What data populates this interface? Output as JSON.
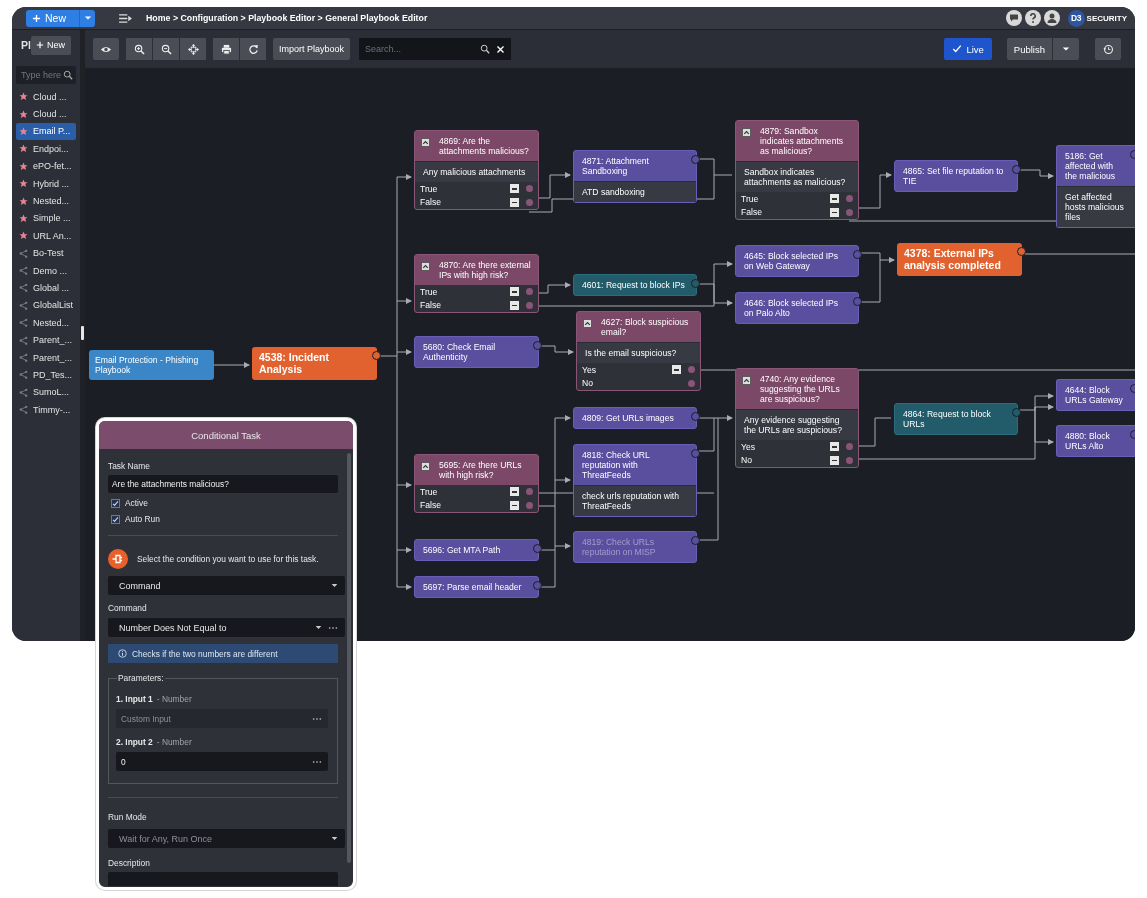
{
  "top_bar": {
    "new_button": "New",
    "breadcrumb": "Home > Configuration > Playbook Editor > General Playbook Editor",
    "logo": {
      "mark": "D3",
      "name": "SECURITY"
    }
  },
  "toolbar": {
    "import_button": "Import Playbook",
    "search": {
      "placeholder": "Search..."
    },
    "live_button": "Live",
    "publish_button": "Publish"
  },
  "sidebar": {
    "title": "Pl",
    "new_button": "New",
    "search": {
      "placeholder": "Type here"
    },
    "items": [
      {
        "label": "Cloud ...",
        "kind": "favorite",
        "selected": false
      },
      {
        "label": "Cloud ...",
        "kind": "favorite",
        "selected": false
      },
      {
        "label": "Email P...",
        "kind": "favorite",
        "selected": true
      },
      {
        "label": "Endpoi...",
        "kind": "favorite",
        "selected": false
      },
      {
        "label": "ePO-fet...",
        "kind": "favorite",
        "selected": false
      },
      {
        "label": "Hybrid ...",
        "kind": "favorite",
        "selected": false
      },
      {
        "label": "Nested...",
        "kind": "favorite",
        "selected": false
      },
      {
        "label": "Simple ...",
        "kind": "favorite",
        "selected": false
      },
      {
        "label": "URL An...",
        "kind": "favorite",
        "selected": false
      },
      {
        "label": "Bo-Test",
        "kind": "shared",
        "selected": false
      },
      {
        "label": "Demo ...",
        "kind": "shared",
        "selected": false
      },
      {
        "label": "Global ...",
        "kind": "shared",
        "selected": false
      },
      {
        "label": "GlobalList",
        "kind": "shared",
        "selected": false
      },
      {
        "label": "Nested...",
        "kind": "shared",
        "selected": false
      },
      {
        "label": "Parent_...",
        "kind": "shared",
        "selected": false
      },
      {
        "label": "Parent_...",
        "kind": "shared",
        "selected": false
      },
      {
        "label": "PD_Tes...",
        "kind": "shared",
        "selected": false
      },
      {
        "label": "SumoL...",
        "kind": "shared",
        "selected": false
      },
      {
        "label": "Timmy-...",
        "kind": "shared",
        "selected": false
      }
    ]
  },
  "canvas": {
    "nodes": [
      {
        "kind": "start",
        "title": "Email Protection - Phishing Playbook",
        "disabled": false
      },
      {
        "kind": "incident",
        "title": "4538: Incident Analysis",
        "disabled": false
      },
      {
        "kind": "conditional",
        "title": "4869: Are the attachments malicious?",
        "description": "Any malicious attachments",
        "disabled": false,
        "outputs": [
          {
            "label": "True",
            "collapsible": true
          },
          {
            "label": "False",
            "collapsible": true
          }
        ]
      },
      {
        "kind": "task",
        "title": "4871: Attachment Sandboxing",
        "description": "ATD sandboxing",
        "disabled": false
      },
      {
        "kind": "conditional",
        "title": "4879: Sandbox indicates attachments as malicious?",
        "description": "Sandbox indicates attachments as malicious?",
        "disabled": false,
        "outputs": [
          {
            "label": "True",
            "collapsible": true
          },
          {
            "label": "False",
            "collapsible": true
          }
        ]
      },
      {
        "kind": "task",
        "title": "4865: Set file reputation to TIE",
        "disabled": false
      },
      {
        "kind": "task",
        "title": "5186: Get affected with the malicious",
        "description": "Get affected hosts malicious files",
        "disabled": false
      },
      {
        "kind": "conditional",
        "title": "4870: Are there external IPs with high risk?",
        "disabled": false,
        "outputs": [
          {
            "label": "True",
            "collapsible": true
          },
          {
            "label": "False",
            "collapsible": true
          }
        ]
      },
      {
        "kind": "request",
        "title": "4601: Request to block IPs",
        "disabled": false
      },
      {
        "kind": "task",
        "title": "4645: Block selected IPs on Web Gateway",
        "disabled": false
      },
      {
        "kind": "task",
        "title": "4646: Block selected IPs on Palo Alto",
        "disabled": false
      },
      {
        "kind": "incident",
        "title": "4378: External IPs analysis completed",
        "disabled": false
      },
      {
        "kind": "task",
        "title": "5680: Check Email Authenticity",
        "disabled": false
      },
      {
        "kind": "conditional",
        "title": "4627: Block suspicious email?",
        "description": "Is the email suspicious?",
        "disabled": false,
        "outputs": [
          {
            "label": "Yes",
            "collapsible": true
          },
          {
            "label": "No",
            "collapsible": false
          }
        ]
      },
      {
        "kind": "task",
        "title": "4809: Get URLs images",
        "disabled": false
      },
      {
        "kind": "conditional",
        "title": "4740: Any evidence suggesting the URLs are suspicious?",
        "description": "Any evidence suggesting the URLs are suspicious?",
        "disabled": false,
        "outputs": [
          {
            "label": "Yes",
            "collapsible": true
          },
          {
            "label": "No",
            "collapsible": true
          }
        ]
      },
      {
        "kind": "request",
        "title": "4864: Request to block URLs",
        "disabled": false
      },
      {
        "kind": "task",
        "title": "4644: Block URLs Gateway",
        "disabled": false
      },
      {
        "kind": "task",
        "title": "4880: Block URLs Alto",
        "disabled": false
      },
      {
        "kind": "conditional",
        "title": "5695: Are there URLs with high risk?",
        "disabled": false,
        "outputs": [
          {
            "label": "True",
            "collapsible": true
          },
          {
            "label": "False",
            "collapsible": true
          }
        ]
      },
      {
        "kind": "task",
        "title": "4818: Check URL reputation with ThreatFeeds",
        "description": "check urls reputation with ThreatFeeds",
        "disabled": false
      },
      {
        "kind": "task",
        "title": "5696: Get MTA Path",
        "disabled": false
      },
      {
        "kind": "task",
        "title": "4819: Check URLs reputation on MISP",
        "disabled": true
      },
      {
        "kind": "task",
        "title": "5697: Parse email header",
        "disabled": false
      }
    ]
  },
  "task_panel": {
    "title": "Conditional Task",
    "task_name": {
      "label": "Task Name",
      "value": "Are the attachments malicious?"
    },
    "options": [
      {
        "label": "Active",
        "checked": true
      },
      {
        "label": "Auto Run",
        "checked": true
      }
    ],
    "condition_prompt": "Select the condition you want to use for this task.",
    "condition_type": "Command",
    "command": {
      "label": "Command",
      "value": "Number Does Not Equal to"
    },
    "info": "Checks if the two numbers are different",
    "parameters": {
      "legend": "Parameters:",
      "inputs": [
        {
          "name": "1. Input 1",
          "type": "- Number",
          "placeholder": "Custom Input"
        },
        {
          "name": "2. Input 2",
          "type": "- Number",
          "value": "0"
        }
      ]
    },
    "run_mode": {
      "label": "Run Mode",
      "value": "Wait for Any, Run Once"
    },
    "description": {
      "label": "Description"
    }
  }
}
